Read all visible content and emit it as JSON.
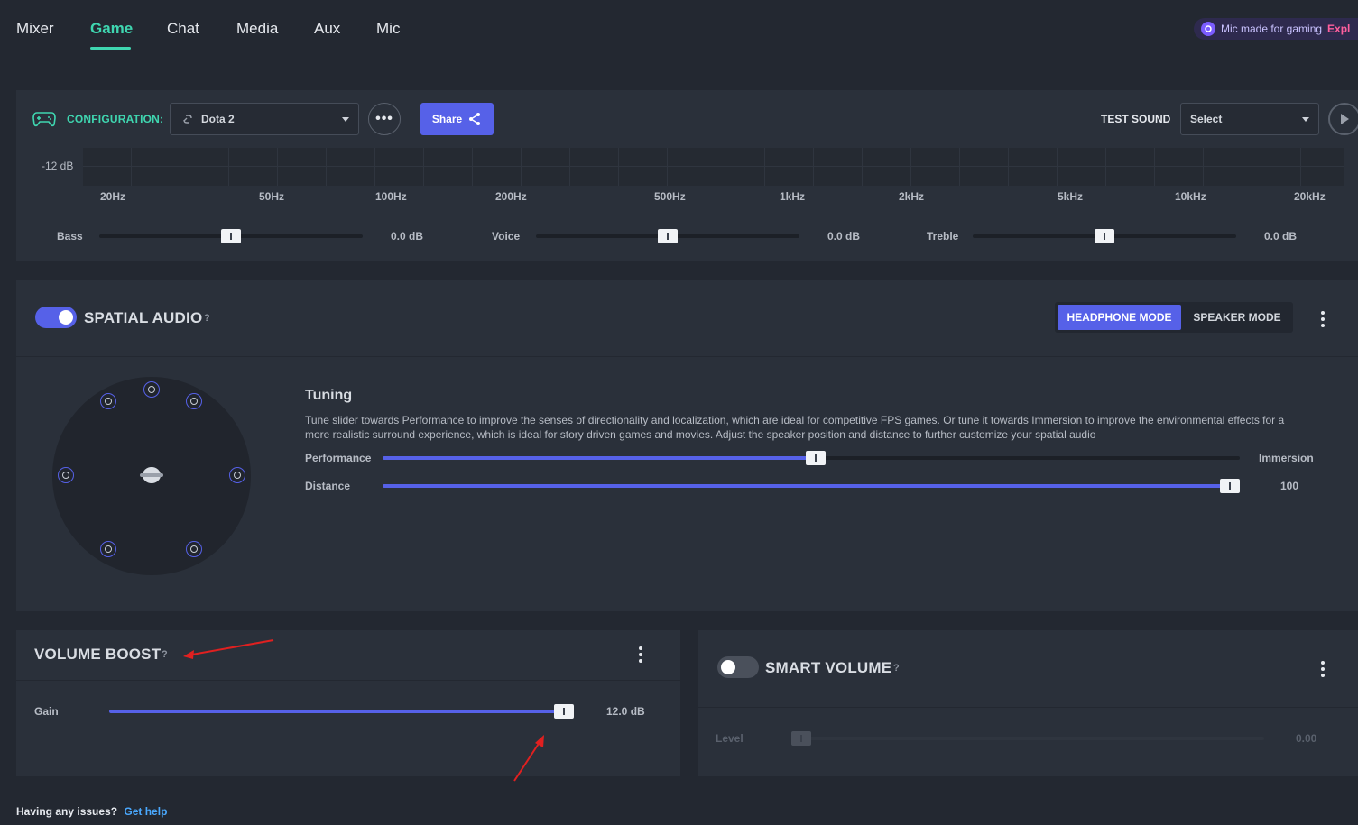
{
  "nav": {
    "tabs": [
      {
        "label": "Mixer"
      },
      {
        "label": "Game"
      },
      {
        "label": "Chat"
      },
      {
        "label": "Media"
      },
      {
        "label": "Aux"
      },
      {
        "label": "Mic"
      }
    ],
    "active_tab": "Game",
    "promo": {
      "text": "Mic made for gaming",
      "link": "Expl"
    }
  },
  "equalizer": {
    "config_label": "CONFIGURATION:",
    "config_value": "Dota 2",
    "more_label": "•••",
    "share_label": "Share",
    "test_sound_label": "TEST SOUND",
    "test_sound_value": "Select",
    "db_label": "-12 dB",
    "frequencies": [
      "20Hz",
      "50Hz",
      "100Hz",
      "200Hz",
      "500Hz",
      "1kHz",
      "2kHz",
      "5kHz",
      "10kHz",
      "20kHz"
    ],
    "bands": [
      {
        "label": "Bass",
        "value": "0.0 dB",
        "level": 0.5
      },
      {
        "label": "Voice",
        "value": "0.0 dB",
        "level": 0.5
      },
      {
        "label": "Treble",
        "value": "0.0 dB",
        "level": 0.5
      }
    ]
  },
  "spatial_audio": {
    "title": "SPATIAL AUDIO",
    "help": "?",
    "enabled": true,
    "modes": [
      "HEADPHONE MODE",
      "SPEAKER MODE"
    ],
    "active_mode": "HEADPHONE MODE",
    "tuning_title": "Tuning",
    "tuning_description": "Tune slider towards Performance to improve the senses of directionality and localization, which are ideal for competitive FPS games. Or tune it towards Immersion to improve the environmental effects for a more realistic surround experience, which is ideal for story driven games and movies. Adjust the speaker position and distance to further customize your spatial audio",
    "performance_label": "Performance",
    "immersion_label": "Immersion",
    "performance_level": 0.505,
    "distance_label": "Distance",
    "distance_value": "100",
    "distance_level": 1.0
  },
  "volume_boost": {
    "title": "VOLUME BOOST",
    "help": "?",
    "gain_label": "Gain",
    "gain_value": "12.0 dB",
    "gain_level": 1.0
  },
  "smart_volume": {
    "title": "SMART VOLUME",
    "help": "?",
    "enabled": false,
    "level_label": "Level",
    "level_value": "0.00",
    "level": 0.0
  },
  "footer": {
    "question": "Having any issues?",
    "link": "Get help"
  },
  "colors": {
    "accent": "#3fd6b0",
    "primary": "#5661e8",
    "annotation_arrow": "#e02020"
  }
}
